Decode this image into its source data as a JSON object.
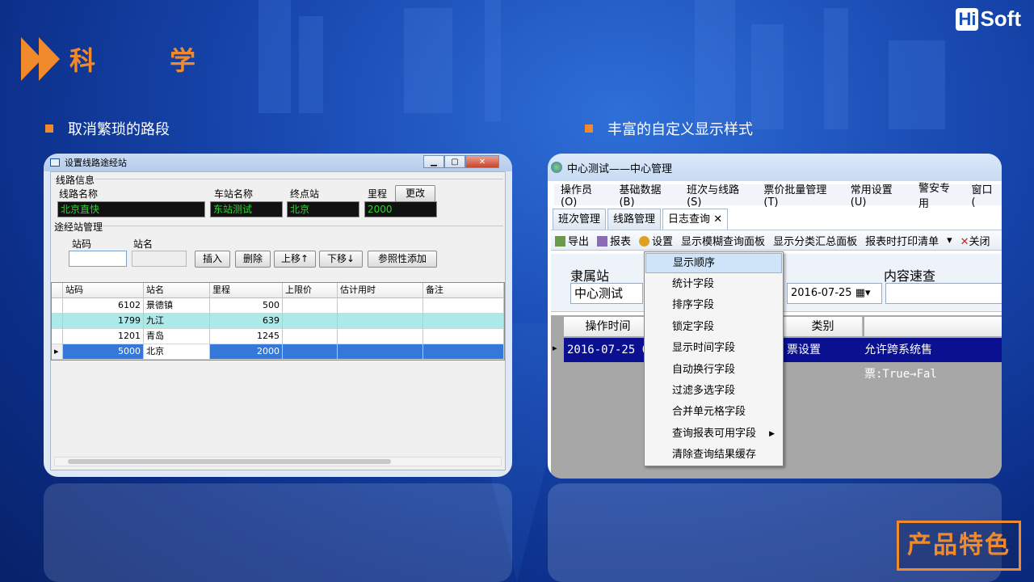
{
  "logo": {
    "hi": "Hi",
    "soft": "Soft"
  },
  "title": "科学",
  "bullets": [
    "取消繁琐的路段",
    "丰富的自定义显示样式"
  ],
  "left_window": {
    "title": "设置线路途经站",
    "group1": "线路信息",
    "labels": {
      "route_name": "线路名称",
      "station_name": "车站名称",
      "terminal": "终点站",
      "mileage": "里程"
    },
    "values": {
      "route_name": "北京直快",
      "station_name": "东站测试",
      "terminal": "北京",
      "mileage": "2000"
    },
    "change_btn": "更改",
    "group2": "途经站管理",
    "code_label": "站码",
    "name_label": "站名",
    "buttons": [
      "插入",
      "删除",
      "上移↑",
      "下移↓",
      "参照性添加"
    ],
    "columns": [
      "站码",
      "站名",
      "里程",
      "上限价",
      "估计用时",
      "备注"
    ],
    "rows": [
      {
        "code": "6102",
        "name": "景德镇",
        "mileage": "500"
      },
      {
        "code": "1799",
        "name": "九江",
        "mileage": "639"
      },
      {
        "code": "1201",
        "name": "青岛",
        "mileage": "1245"
      },
      {
        "code": "5000",
        "name": "北京",
        "mileage": "2000"
      }
    ]
  },
  "right_window": {
    "title": "中心测试——中心管理",
    "menu": [
      "操作员(O)",
      "基础数据(B)",
      "班次与线路(S)",
      "票价批量管理(T)",
      "常用设置(U)",
      "警安专用",
      "窗口("
    ],
    "tabs": [
      "班次管理",
      "线路管理",
      "日志查询"
    ],
    "tab_close": "✕",
    "toolbar": [
      "导出",
      "报表",
      "设置",
      "显示模糊查询面板",
      "显示分类汇总面板",
      "报表时打印清单",
      "关闭"
    ],
    "panel": {
      "station_label": "隶属站",
      "station_value": "中心测试",
      "date": "2016-07-25",
      "search_label": "内容速查"
    },
    "grid_headers": [
      "操作时间",
      "类别"
    ],
    "grid_row": {
      "time": "2016-07-25 09",
      "category": "票设置",
      "content": "允许跨系统售票:True→Fal"
    },
    "context_menu": [
      "显示顺序",
      "统计字段",
      "排序字段",
      "锁定字段",
      "显示时间字段",
      "自动换行字段",
      "过滤多选字段",
      "合并单元格字段",
      "查询报表可用字段",
      "清除查询结果缓存"
    ]
  },
  "badge": "产品特色",
  "colors": {
    "accent": "#f08a2c",
    "selection": "#3478d9",
    "cyan_row": "#aee9ea",
    "grid_row_dark": "#0a1090"
  }
}
